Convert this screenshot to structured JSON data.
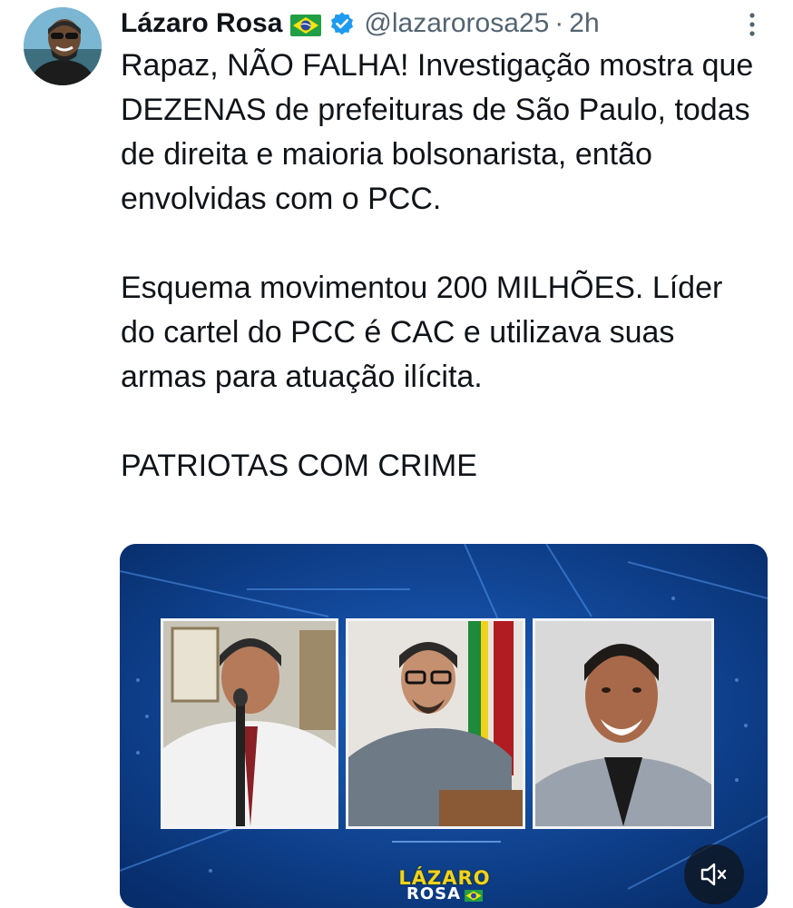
{
  "tweet": {
    "author_name": "Lázaro Rosa",
    "flag_icon": "brazil-flag-icon",
    "verified_icon": "verified-badge-icon",
    "handle": "@lazarorosa25",
    "separator": "·",
    "timestamp": "2h",
    "paragraphs": [
      "Rapaz, NÃO FALHA! Investigação mostra que DEZENAS de prefeituras de São Paulo, todas de direita e maioria bolsonarista, então envolvidas com o PCC.",
      "Esquema movimentou 200 MILHÕES. Líder do cartel do PCC é CAC e utilizava suas armas para atuação ilícita.",
      "PATRIOTAS COM CRIME"
    ]
  },
  "media": {
    "brand_line1": "LÁZARO",
    "brand_line2": "ROSA",
    "mute_icon": "speaker-muted-icon",
    "colors": {
      "background": "#0b3f8e",
      "brand_yellow": "#f6d21a"
    }
  },
  "colors": {
    "text": "#0f1419",
    "secondary": "#536471",
    "verified": "#1d9bf0"
  }
}
